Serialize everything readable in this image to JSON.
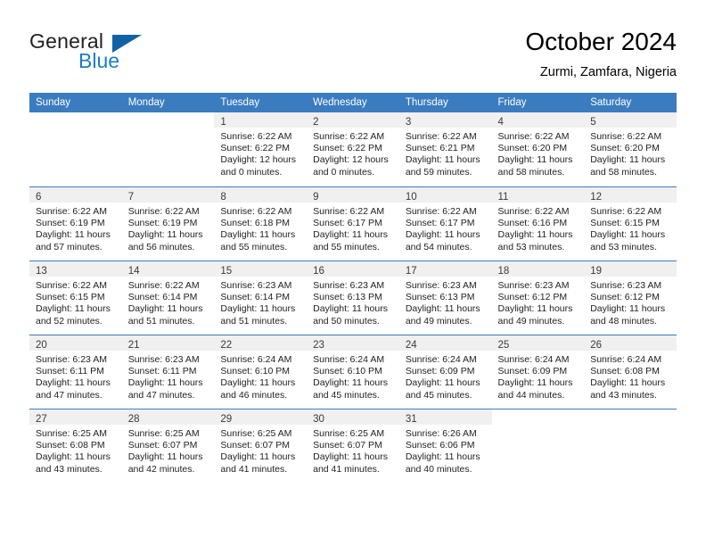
{
  "brand": {
    "name_part1": "General",
    "name_part2": "Blue",
    "flag_icon": "triangle-flag-icon"
  },
  "header": {
    "title": "October 2024",
    "subtitle": "Zurmi, Zamfara, Nigeria"
  },
  "colors": {
    "header_blue": "#3b7cc0",
    "brand_blue": "#1a7fc1",
    "daynum_shade": "#f0f0f0"
  },
  "weekday_headers": [
    "Sunday",
    "Monday",
    "Tuesday",
    "Wednesday",
    "Thursday",
    "Friday",
    "Saturday"
  ],
  "weeks": [
    [
      {
        "day": "",
        "blank": true
      },
      {
        "day": "",
        "blank": true
      },
      {
        "day": "1",
        "sunrise": "Sunrise: 6:22 AM",
        "sunset": "Sunset: 6:22 PM",
        "daylight": "Daylight: 12 hours and 0 minutes."
      },
      {
        "day": "2",
        "sunrise": "Sunrise: 6:22 AM",
        "sunset": "Sunset: 6:22 PM",
        "daylight": "Daylight: 12 hours and 0 minutes."
      },
      {
        "day": "3",
        "sunrise": "Sunrise: 6:22 AM",
        "sunset": "Sunset: 6:21 PM",
        "daylight": "Daylight: 11 hours and 59 minutes."
      },
      {
        "day": "4",
        "sunrise": "Sunrise: 6:22 AM",
        "sunset": "Sunset: 6:20 PM",
        "daylight": "Daylight: 11 hours and 58 minutes."
      },
      {
        "day": "5",
        "sunrise": "Sunrise: 6:22 AM",
        "sunset": "Sunset: 6:20 PM",
        "daylight": "Daylight: 11 hours and 58 minutes."
      }
    ],
    [
      {
        "day": "6",
        "sunrise": "Sunrise: 6:22 AM",
        "sunset": "Sunset: 6:19 PM",
        "daylight": "Daylight: 11 hours and 57 minutes."
      },
      {
        "day": "7",
        "sunrise": "Sunrise: 6:22 AM",
        "sunset": "Sunset: 6:19 PM",
        "daylight": "Daylight: 11 hours and 56 minutes."
      },
      {
        "day": "8",
        "sunrise": "Sunrise: 6:22 AM",
        "sunset": "Sunset: 6:18 PM",
        "daylight": "Daylight: 11 hours and 55 minutes."
      },
      {
        "day": "9",
        "sunrise": "Sunrise: 6:22 AM",
        "sunset": "Sunset: 6:17 PM",
        "daylight": "Daylight: 11 hours and 55 minutes."
      },
      {
        "day": "10",
        "sunrise": "Sunrise: 6:22 AM",
        "sunset": "Sunset: 6:17 PM",
        "daylight": "Daylight: 11 hours and 54 minutes."
      },
      {
        "day": "11",
        "sunrise": "Sunrise: 6:22 AM",
        "sunset": "Sunset: 6:16 PM",
        "daylight": "Daylight: 11 hours and 53 minutes."
      },
      {
        "day": "12",
        "sunrise": "Sunrise: 6:22 AM",
        "sunset": "Sunset: 6:15 PM",
        "daylight": "Daylight: 11 hours and 53 minutes."
      }
    ],
    [
      {
        "day": "13",
        "sunrise": "Sunrise: 6:22 AM",
        "sunset": "Sunset: 6:15 PM",
        "daylight": "Daylight: 11 hours and 52 minutes."
      },
      {
        "day": "14",
        "sunrise": "Sunrise: 6:22 AM",
        "sunset": "Sunset: 6:14 PM",
        "daylight": "Daylight: 11 hours and 51 minutes."
      },
      {
        "day": "15",
        "sunrise": "Sunrise: 6:23 AM",
        "sunset": "Sunset: 6:14 PM",
        "daylight": "Daylight: 11 hours and 51 minutes."
      },
      {
        "day": "16",
        "sunrise": "Sunrise: 6:23 AM",
        "sunset": "Sunset: 6:13 PM",
        "daylight": "Daylight: 11 hours and 50 minutes."
      },
      {
        "day": "17",
        "sunrise": "Sunrise: 6:23 AM",
        "sunset": "Sunset: 6:13 PM",
        "daylight": "Daylight: 11 hours and 49 minutes."
      },
      {
        "day": "18",
        "sunrise": "Sunrise: 6:23 AM",
        "sunset": "Sunset: 6:12 PM",
        "daylight": "Daylight: 11 hours and 49 minutes."
      },
      {
        "day": "19",
        "sunrise": "Sunrise: 6:23 AM",
        "sunset": "Sunset: 6:12 PM",
        "daylight": "Daylight: 11 hours and 48 minutes."
      }
    ],
    [
      {
        "day": "20",
        "sunrise": "Sunrise: 6:23 AM",
        "sunset": "Sunset: 6:11 PM",
        "daylight": "Daylight: 11 hours and 47 minutes."
      },
      {
        "day": "21",
        "sunrise": "Sunrise: 6:23 AM",
        "sunset": "Sunset: 6:11 PM",
        "daylight": "Daylight: 11 hours and 47 minutes."
      },
      {
        "day": "22",
        "sunrise": "Sunrise: 6:24 AM",
        "sunset": "Sunset: 6:10 PM",
        "daylight": "Daylight: 11 hours and 46 minutes."
      },
      {
        "day": "23",
        "sunrise": "Sunrise: 6:24 AM",
        "sunset": "Sunset: 6:10 PM",
        "daylight": "Daylight: 11 hours and 45 minutes."
      },
      {
        "day": "24",
        "sunrise": "Sunrise: 6:24 AM",
        "sunset": "Sunset: 6:09 PM",
        "daylight": "Daylight: 11 hours and 45 minutes."
      },
      {
        "day": "25",
        "sunrise": "Sunrise: 6:24 AM",
        "sunset": "Sunset: 6:09 PM",
        "daylight": "Daylight: 11 hours and 44 minutes."
      },
      {
        "day": "26",
        "sunrise": "Sunrise: 6:24 AM",
        "sunset": "Sunset: 6:08 PM",
        "daylight": "Daylight: 11 hours and 43 minutes."
      }
    ],
    [
      {
        "day": "27",
        "sunrise": "Sunrise: 6:25 AM",
        "sunset": "Sunset: 6:08 PM",
        "daylight": "Daylight: 11 hours and 43 minutes."
      },
      {
        "day": "28",
        "sunrise": "Sunrise: 6:25 AM",
        "sunset": "Sunset: 6:07 PM",
        "daylight": "Daylight: 11 hours and 42 minutes."
      },
      {
        "day": "29",
        "sunrise": "Sunrise: 6:25 AM",
        "sunset": "Sunset: 6:07 PM",
        "daylight": "Daylight: 11 hours and 41 minutes."
      },
      {
        "day": "30",
        "sunrise": "Sunrise: 6:25 AM",
        "sunset": "Sunset: 6:07 PM",
        "daylight": "Daylight: 11 hours and 41 minutes."
      },
      {
        "day": "31",
        "sunrise": "Sunrise: 6:26 AM",
        "sunset": "Sunset: 6:06 PM",
        "daylight": "Daylight: 11 hours and 40 minutes."
      },
      {
        "day": "",
        "blank": true
      },
      {
        "day": "",
        "blank": true
      }
    ]
  ]
}
